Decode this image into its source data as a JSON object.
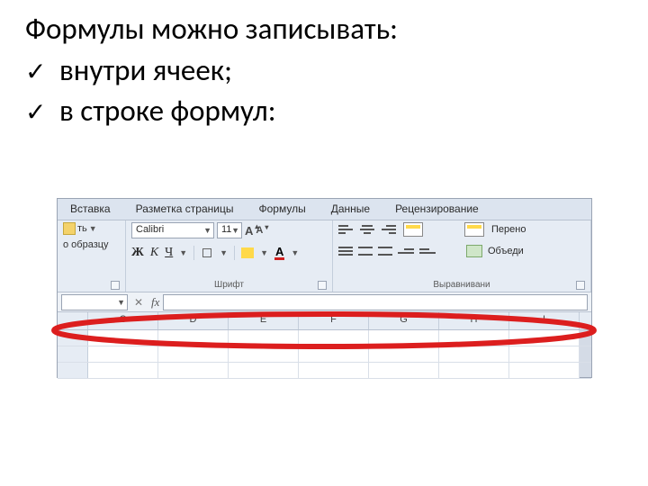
{
  "heading": "Формулы можно записывать:",
  "bullets": [
    "внутри ячеек;",
    "в строке формул:"
  ],
  "tabs": {
    "vstavka": "Вставка",
    "razmetka": "Разметка страницы",
    "formuly": "Формулы",
    "dannye": "Данные",
    "recenz": "Рецензирование"
  },
  "clipboard": {
    "paste_suffix": "ть",
    "format_painter": "о образцу"
  },
  "font": {
    "name": "Calibri",
    "size": "11",
    "bold": "Ж",
    "italic": "К",
    "underline": "Ч",
    "group_label": "Шрифт"
  },
  "alignment": {
    "group_label": "Выравнивани",
    "wrap_text": "Перено",
    "merge": "Объеди"
  },
  "columns": [
    "C",
    "D",
    "E",
    "F",
    "G",
    "H",
    "I"
  ],
  "fx_label": "fx"
}
